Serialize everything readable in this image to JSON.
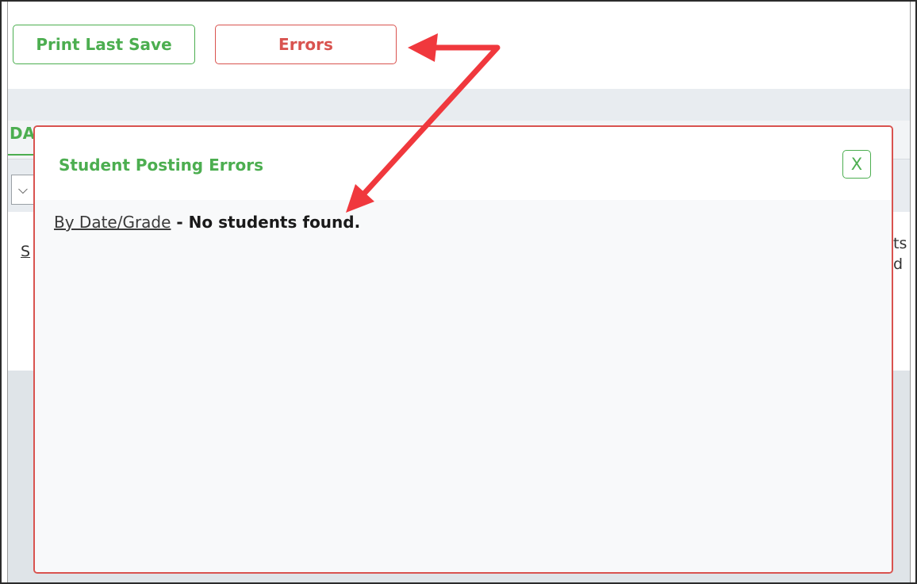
{
  "toolbar": {
    "print_label": "Print Last Save",
    "errors_label": "Errors"
  },
  "background_page": {
    "tab_partial": "DA",
    "link_partial": "S",
    "right_partial_1": "ts",
    "right_partial_2": "d",
    "select_glyph": "⌵"
  },
  "modal": {
    "title": "Student Posting Errors",
    "close_label": "X",
    "link_label": "By Date/Grade",
    "separator": " - ",
    "message": "No students found."
  },
  "colors": {
    "accent_green": "#4cae50",
    "accent_red": "#d9534f",
    "annotation_arrow": "#f0383d"
  },
  "annotation": {
    "arrow_icon": "annotation-arrow-icon"
  }
}
